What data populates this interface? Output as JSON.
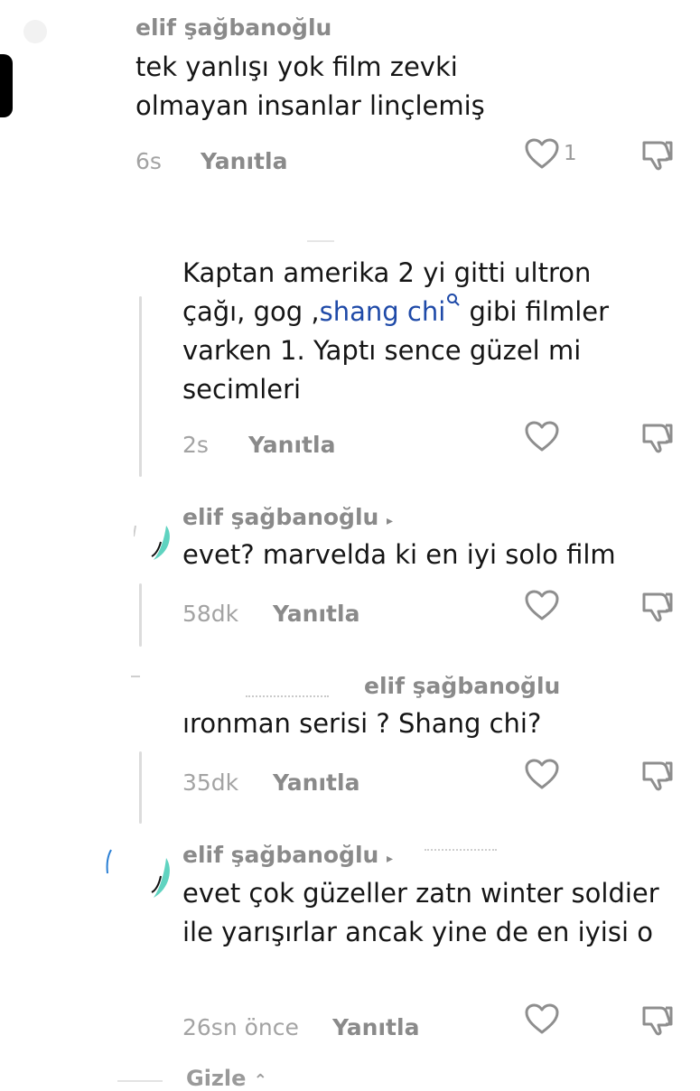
{
  "comments": [
    {
      "username": "elif şağbanoğlu",
      "text": "tek yanlışı yok film zevki olmayan insanlar linçlemiş",
      "time": "6s",
      "reply_label": "Yanıtla",
      "like_count": "1"
    },
    {
      "text_before_link": "Kaptan amerika 2 yi gitti ultron çağı, gog ,",
      "link_text": "shang chi",
      "text_after_link": " gibi filmler varken 1. Yaptı sence güzel mi secimleri",
      "time": "2s",
      "reply_label": "Yanıtla"
    },
    {
      "username": "elif şağbanoğlu",
      "username_suffix": "▸",
      "text": "evet? marvelda ki en iyi solo film",
      "time": "58dk",
      "reply_label": "Yanıtla"
    },
    {
      "username": "elif şağbanoğlu",
      "text": "ıronman serisi ? Shang chi?",
      "time": "35dk",
      "reply_label": "Yanıtla"
    },
    {
      "username": "elif şağbanoğlu",
      "username_suffix": "▸",
      "text": "evet çok güzeller zatn winter soldier ile yarışırlar ancak yine de en iyisi o",
      "time": "26sn önce",
      "reply_label": "Yanıtla"
    }
  ],
  "footer": {
    "hide_label": "Gizle"
  },
  "icons": {
    "like": "heart-outline-icon",
    "dislike": "thumbs-down-icon",
    "search_glyph": "magnifier-icon"
  },
  "colors": {
    "link": "#1f4aa8",
    "avatar_accent": "#5fd3c0"
  }
}
